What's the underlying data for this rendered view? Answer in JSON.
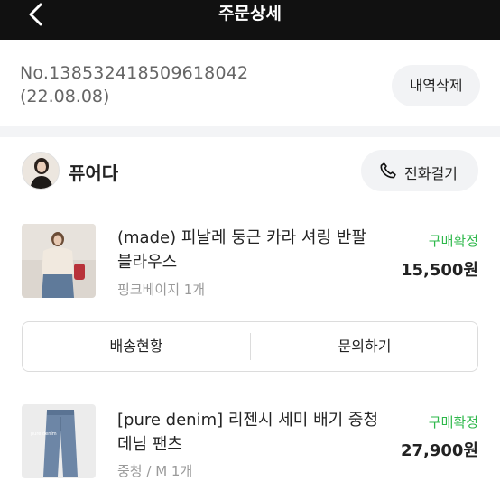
{
  "header": {
    "title": "주문상세"
  },
  "order": {
    "number": "No.138532418509618042",
    "date": "(22.08.08)",
    "delete_label": "내역삭제"
  },
  "shop": {
    "name": "퓨어다",
    "call_label": "전화걸기"
  },
  "items": [
    {
      "name": "(made) 피날레 둥근 카라 셔링 반팔 블라우스",
      "option": "핑크베이지 1개",
      "status": "구매확정",
      "price": "15,500원"
    },
    {
      "name": "[pure denim] 리젠시 세미 배기 중청 데님 팬츠",
      "option": "중청 / M 1개",
      "status": "구매확정",
      "price": "27,900원"
    }
  ],
  "actions": {
    "shipping_label": "배송현황",
    "inquiry_label": "문의하기"
  },
  "colors": {
    "header_bg": "#111111",
    "accent_green": "#2eb84b",
    "pill_bg": "#f2f3f5"
  },
  "icons": {
    "back": "chevron-left-icon",
    "call": "phone-icon"
  }
}
